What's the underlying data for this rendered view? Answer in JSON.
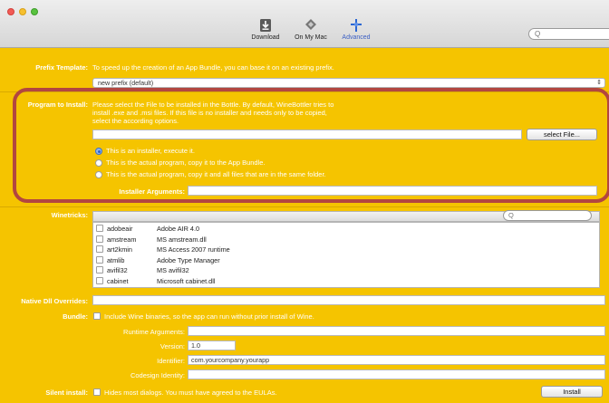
{
  "toolbar": {
    "download_label": "Download",
    "onmymac_label": "On My Mac",
    "advanced_label": "Advanced",
    "search_glyph": "Q"
  },
  "prefix": {
    "label": "Prefix Template:",
    "help": "To speed up the creation of an App Bundle, you can base it on an existing prefix.",
    "selected": "new prefix (default)"
  },
  "program": {
    "label": "Program to Install:",
    "help_1": "Please select the File to be installed in the Bottle. By default, WineBottler tries to",
    "help_2": "install .exe and .msi files. If this file is no installer and needs only to be copied,",
    "help_3": "select the according options.",
    "file_value": "",
    "select_file_label": "select File...",
    "options": [
      {
        "label": "This is an installer, execute it.",
        "selected": true
      },
      {
        "label": "This is the actual program, copy it to the App Bundle.",
        "selected": false
      },
      {
        "label": "This is the actual program, copy it and all files that are in the same folder.",
        "selected": false
      }
    ],
    "installer_args_label": "Installer Arguments:",
    "installer_args_value": ""
  },
  "winetricks": {
    "label": "Winetricks:",
    "search_glyph": "Q",
    "items": [
      {
        "name": "adobeair",
        "desc": "Adobe AIR 4.0"
      },
      {
        "name": "amstream",
        "desc": "MS amstream.dll"
      },
      {
        "name": "art2kmin",
        "desc": "MS Access 2007 runtime"
      },
      {
        "name": "atmlib",
        "desc": "Adobe Type Manager"
      },
      {
        "name": "avifil32",
        "desc": "MS avifil32"
      },
      {
        "name": "cabinet",
        "desc": "Microsoft cabinet.dll"
      }
    ]
  },
  "dll_overrides": {
    "label": "Native Dll Overrides:",
    "value": ""
  },
  "bundle": {
    "label": "Bundle:",
    "text": "Include Wine binaries, so the app can run without prior install of Wine.",
    "runtime_label": "Runtime Arguments:",
    "runtime_value": "",
    "version_label": "Version:",
    "version_value": "1.0",
    "identifier_label": "Identifier:",
    "identifier_value": "com.yourcompany.yourapp",
    "codesign_label": "Codesign Identity:",
    "codesign_value": ""
  },
  "silent": {
    "label": "Silent install:",
    "text": "Hides most dialogs. You must have agreed to the EULAs.",
    "install_label": "Install"
  }
}
